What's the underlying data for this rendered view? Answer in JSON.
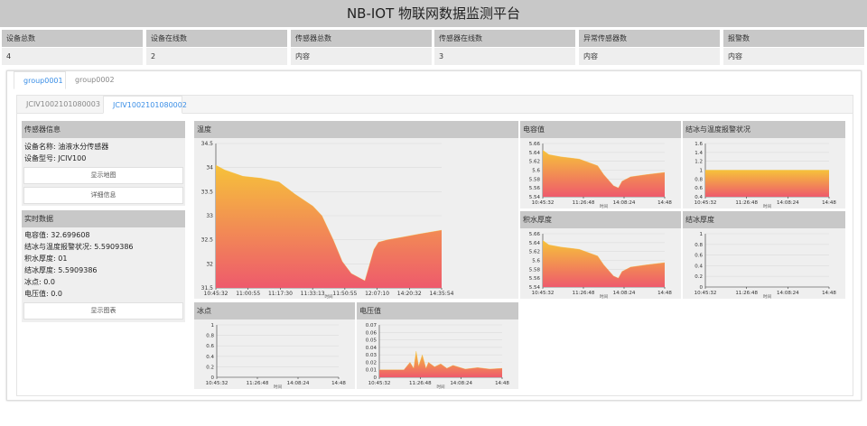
{
  "app": {
    "title": "NB-IOT 物联网数据监测平台"
  },
  "stats": [
    {
      "label": "设备总数",
      "value": "4"
    },
    {
      "label": "设备在线数",
      "value": "2"
    },
    {
      "label": "传感器总数",
      "value": "内容"
    },
    {
      "label": "传感器在线数",
      "value": "3"
    },
    {
      "label": "异常传感器数",
      "value": "内容"
    },
    {
      "label": "报警数",
      "value": "内容"
    }
  ],
  "group_tabs": [
    {
      "label": "group0001",
      "active": true
    },
    {
      "label": "group0002",
      "active": false
    }
  ],
  "device_tabs": [
    {
      "label": "JCIV1002101080003",
      "active": false
    },
    {
      "label": "JCIV1002101080002",
      "active": true
    }
  ],
  "sensor_info": {
    "title": "传感器信息",
    "name_line": "设备名称: 油液水分传感器",
    "model_line": "设备型号: JCIV100",
    "map_button": "显示地图",
    "detail_button": "详细信息"
  },
  "realtime": {
    "title": "实时数据",
    "lines": [
      "电容值: 32.699608",
      "结冰与温度报警状况: 5.5909386",
      "积水厚度: 01",
      "结冰厚度: 5.5909386",
      "冰点: 0.0",
      "电压值: 0.0"
    ],
    "chart_button": "显示图表"
  },
  "chart_data": [
    {
      "id": "temp",
      "type": "area",
      "title": "温度",
      "xlabel": "时间",
      "ylim": [
        31.5,
        34.5
      ],
      "yticks": [
        31.5,
        32,
        32.5,
        33,
        33.5,
        34,
        34.5
      ],
      "xticks": [
        "10:45:32",
        "11:00:55",
        "11:17:30",
        "11:33:13",
        "11:50:55",
        "12:07:10",
        "14:20:32",
        "14:35:54"
      ],
      "x": [
        0,
        0.04,
        0.12,
        0.2,
        0.28,
        0.35,
        0.43,
        0.47,
        0.52,
        0.56,
        0.6,
        0.66,
        0.7,
        0.72,
        0.76,
        0.82,
        0.9,
        1
      ],
      "y": [
        34.05,
        33.95,
        33.82,
        33.78,
        33.7,
        33.45,
        33.2,
        33.0,
        32.5,
        32.05,
        31.8,
        31.65,
        32.3,
        32.45,
        32.5,
        32.55,
        32.62,
        32.7
      ]
    },
    {
      "id": "capacitance",
      "type": "area",
      "title": "电容值",
      "xlabel": "时间",
      "ylim": [
        5.54,
        5.66
      ],
      "yticks": [
        5.54,
        5.56,
        5.58,
        5.6,
        5.62,
        5.64,
        5.66
      ],
      "xticks": [
        "10:45:32",
        "11:26:48",
        "14:08:24",
        "14:48"
      ],
      "x": [
        0,
        0.05,
        0.15,
        0.3,
        0.45,
        0.5,
        0.58,
        0.62,
        0.65,
        0.72,
        0.85,
        1
      ],
      "y": [
        5.645,
        5.635,
        5.63,
        5.625,
        5.61,
        5.59,
        5.565,
        5.56,
        5.575,
        5.585,
        5.59,
        5.595
      ]
    },
    {
      "id": "icing-alarm",
      "type": "area",
      "title": "结冰与温度报警状况",
      "xlabel": "时间",
      "ylim": [
        0.4,
        1.6
      ],
      "yticks": [
        0.4,
        0.6,
        0.8,
        1,
        1.2,
        1.4,
        1.6
      ],
      "xticks": [
        "10:45:32",
        "11:26:48",
        "14:08:24",
        "14:48"
      ],
      "x": [
        0,
        1
      ],
      "y": [
        1,
        1
      ]
    },
    {
      "id": "water",
      "type": "area",
      "title": "积水厚度",
      "xlabel": "时间",
      "ylim": [
        5.54,
        5.66
      ],
      "yticks": [
        5.54,
        5.56,
        5.58,
        5.6,
        5.62,
        5.64,
        5.66
      ],
      "xticks": [
        "10:45:32",
        "11:26:48",
        "14:08:24",
        "14:48"
      ],
      "x": [
        0,
        0.05,
        0.15,
        0.3,
        0.45,
        0.5,
        0.58,
        0.62,
        0.65,
        0.72,
        0.85,
        1
      ],
      "y": [
        5.645,
        5.635,
        5.63,
        5.625,
        5.61,
        5.59,
        5.565,
        5.56,
        5.575,
        5.585,
        5.59,
        5.595
      ]
    },
    {
      "id": "ice-thick",
      "type": "line",
      "title": "结冰厚度",
      "xlabel": "时间",
      "ylim": [
        0,
        1
      ],
      "yticks": [
        0,
        0.2,
        0.4,
        0.6,
        0.8,
        1
      ],
      "xticks": [
        "10:45:32",
        "11:26:48",
        "14:08:24",
        "14:48"
      ],
      "x": [],
      "y": []
    },
    {
      "id": "freeze",
      "type": "line",
      "title": "冰点",
      "xlabel": "时间",
      "ylim": [
        0,
        1
      ],
      "yticks": [
        0,
        0.2,
        0.4,
        0.6,
        0.8,
        1
      ],
      "xticks": [
        "10:45:32",
        "11:26:48",
        "14:08:24",
        "14:48"
      ],
      "x": [],
      "y": []
    },
    {
      "id": "voltage",
      "type": "area",
      "title": "电压值",
      "xlabel": "时间",
      "ylim": [
        0,
        0.07
      ],
      "yticks": [
        0,
        0.01,
        0.02,
        0.03,
        0.04,
        0.05,
        0.06,
        0.07
      ],
      "xticks": [
        "10:45:32",
        "11:26:48",
        "14:08:24",
        "14:48"
      ],
      "x": [
        0,
        0.1,
        0.2,
        0.25,
        0.28,
        0.3,
        0.32,
        0.35,
        0.38,
        0.4,
        0.45,
        0.5,
        0.55,
        0.6,
        0.7,
        0.8,
        0.9,
        1
      ],
      "y": [
        0.01,
        0.01,
        0.01,
        0.02,
        0.012,
        0.035,
        0.015,
        0.03,
        0.012,
        0.02,
        0.014,
        0.018,
        0.012,
        0.016,
        0.011,
        0.013,
        0.011,
        0.012
      ]
    }
  ],
  "colors": {
    "grad_top": "#f6c23a",
    "grad_bottom": "#ee5a6c",
    "panel_header": "#c8c8c8",
    "accent": "#3a8ee6"
  }
}
